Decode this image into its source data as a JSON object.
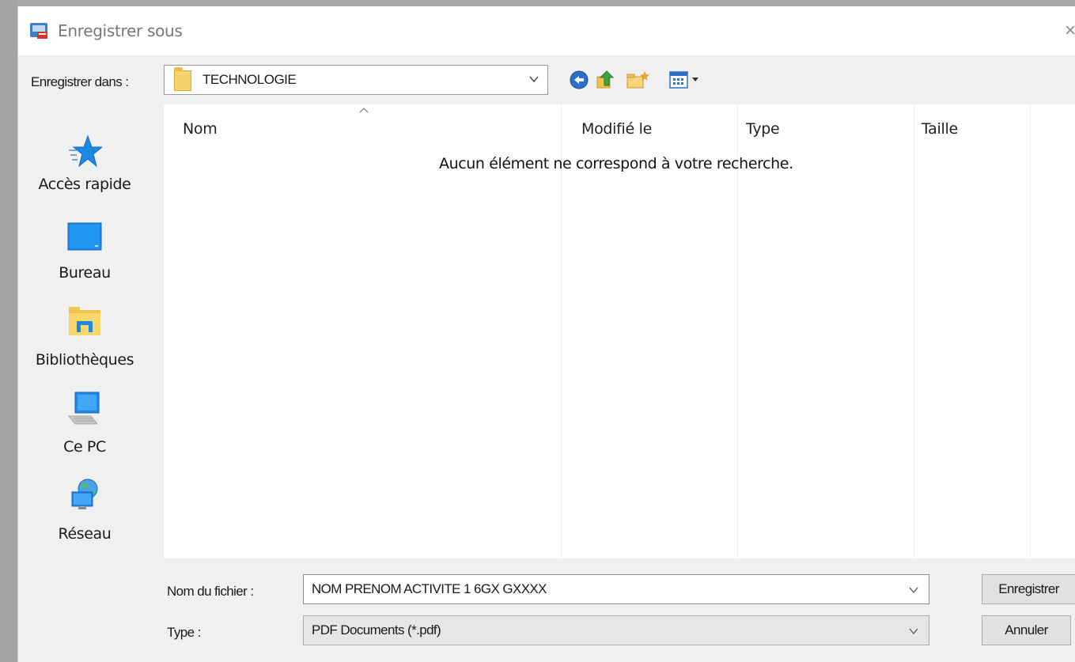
{
  "window": {
    "title": "Enregistrer sous",
    "close_glyph": "×"
  },
  "toolbar": {
    "lookin_label": "Enregistrer dans :",
    "lookin_value": "TECHNOLOGIE",
    "icons": [
      "back-icon",
      "up-folder-icon",
      "new-folder-icon",
      "view-menu-icon"
    ]
  },
  "places": [
    {
      "label": "Accès rapide",
      "icon": "quick-access-star-icon"
    },
    {
      "label": "Bureau",
      "icon": "desktop-icon"
    },
    {
      "label": "Bibliothèques",
      "icon": "libraries-icon"
    },
    {
      "label": "Ce PC",
      "icon": "computer-icon"
    },
    {
      "label": "Réseau",
      "icon": "network-icon"
    }
  ],
  "filelist": {
    "columns": [
      "Nom",
      "Modifié le",
      "Type",
      "Taille"
    ],
    "empty_message": "Aucun élément ne correspond à votre recherche."
  },
  "filename": {
    "label": "Nom du fichier :",
    "value": "NOM PRENOM ACTIVITE 1 6GX GXXXX"
  },
  "filetype": {
    "label": "Type :",
    "value": "PDF Documents (*.pdf)"
  },
  "buttons": {
    "save": "Enregistrer",
    "cancel": "Annuler"
  },
  "colors": {
    "accent_blue": "#1e88e5",
    "folder_yellow": "#f7d26b",
    "list_background": "#ffffff",
    "dialog_background": "#f0f0f0"
  }
}
